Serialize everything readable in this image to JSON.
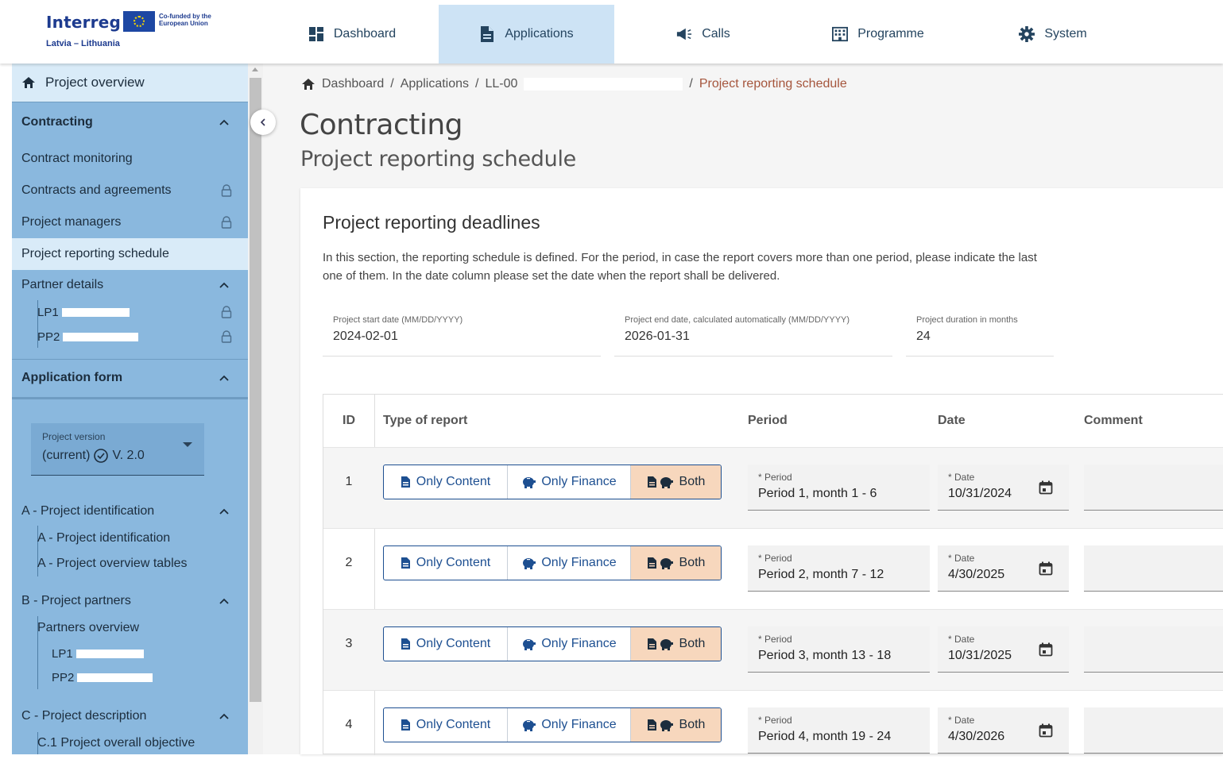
{
  "brand": {
    "name": "Interreg",
    "eu_text": "Co-funded by the European Union",
    "region": "Latvia – Lithuania"
  },
  "nav": [
    {
      "label": "Dashboard",
      "icon": "dashboard-icon",
      "active": false
    },
    {
      "label": "Applications",
      "icon": "document-icon",
      "active": true
    },
    {
      "label": "Calls",
      "icon": "megaphone-icon",
      "active": false
    },
    {
      "label": "Programme",
      "icon": "building-icon",
      "active": false
    },
    {
      "label": "System",
      "icon": "gear-icon",
      "active": false
    }
  ],
  "sidebar": {
    "project_overview": "Project overview",
    "contracting": "Contracting",
    "contract_monitoring": "Contract monitoring",
    "contracts_agreements": "Contracts and agreements",
    "project_managers": "Project managers",
    "reporting_schedule": "Project reporting schedule",
    "partner_details": "Partner details",
    "partner_lp1": "LP1",
    "partner_pp2": "PP2",
    "application_form": "Application form",
    "version_label": "Project version",
    "version_value": "(current)",
    "version_number": "V. 2.0",
    "section_a": "A - Project identification",
    "section_a_1": "A - Project identification",
    "section_a_2": "A - Project overview tables",
    "section_b": "B - Project partners",
    "section_b_1": "Partners overview",
    "section_b_lp1": "LP1",
    "section_b_pp2": "PP2",
    "section_c": "C - Project description",
    "section_c_1": "C.1 Project overall objective"
  },
  "breadcrumb": {
    "home": "Dashboard",
    "applications": "Applications",
    "project": "LL-00",
    "current": "Project reporting schedule",
    "separator": "/"
  },
  "page": {
    "title": "Contracting",
    "subtitle": "Project reporting schedule"
  },
  "card": {
    "title": "Project reporting deadlines",
    "description": "In this section, the reporting schedule is defined. For the period, in case the report covers more than one period, please indicate the last one of them. In the date column please set the date when the report shall be delivered.",
    "start_label": "Project start date (MM/DD/YYYY)",
    "start_value": "2024-02-01",
    "end_label": "Project end date, calculated automatically (MM/DD/YYYY)",
    "end_value": "2026-01-31",
    "duration_label": "Project duration in months",
    "duration_value": "24"
  },
  "table": {
    "headers": {
      "id": "ID",
      "type": "Type of report",
      "period": "Period",
      "date": "Date",
      "comment": "Comment"
    },
    "toggle_labels": {
      "content": "Only Content",
      "finance": "Only Finance",
      "both": "Both"
    },
    "period_label": "* Period",
    "date_label": "* Date",
    "rows": [
      {
        "id": "1",
        "type": "both",
        "period": "Period 1, month 1 - 6",
        "date": "10/31/2024",
        "comment": ""
      },
      {
        "id": "2",
        "type": "both",
        "period": "Period 2, month 7 - 12",
        "date": "4/30/2025",
        "comment": ""
      },
      {
        "id": "3",
        "type": "both",
        "period": "Period 3, month 13 - 18",
        "date": "10/31/2025",
        "comment": ""
      },
      {
        "id": "4",
        "type": "both",
        "period": "Period 4, month 19 - 24",
        "date": "4/30/2026",
        "comment": ""
      }
    ]
  },
  "colors": {
    "accent": "#1d4f91",
    "sidebar": "#8ab8de",
    "selected_toggle": "#f7d7bd",
    "breadcrumb_current": "#a5553c"
  }
}
